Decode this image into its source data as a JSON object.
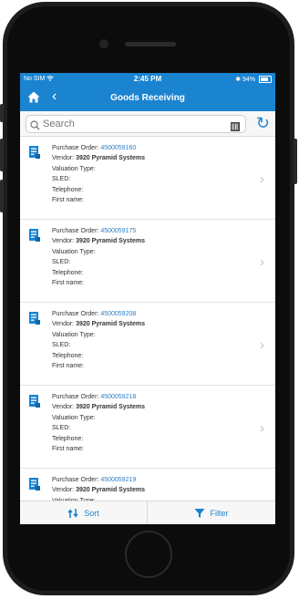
{
  "status_bar": {
    "carrier": "No SIM",
    "time": "2:45 PM",
    "battery": "94%"
  },
  "nav": {
    "title": "Goods Receiving",
    "home_icon": "home-icon",
    "back_icon": "chevron-left-icon"
  },
  "search": {
    "placeholder": "Search"
  },
  "labels": {
    "purchase_order": "Purchase Order:",
    "vendor": "Vendor:",
    "valuation_type": "Valuation Type:",
    "sled": "SLED:",
    "telephone": "Telephone:",
    "first_name": "First name:"
  },
  "items": [
    {
      "po_number": "4500059160",
      "vendor": "3920 Pyramid Systems"
    },
    {
      "po_number": "4500059175",
      "vendor": "3920 Pyramid Systems"
    },
    {
      "po_number": "4500059208",
      "vendor": "3920 Pyramid Systems"
    },
    {
      "po_number": "4500059218",
      "vendor": "3920 Pyramid Systems"
    },
    {
      "po_number": "4500059219",
      "vendor": "3920 Pyramid Systems"
    }
  ],
  "bottom_bar": {
    "sort_label": "Sort",
    "filter_label": "Filter"
  },
  "colors": {
    "accent": "#1a84d1",
    "link": "#2a7fc8"
  }
}
